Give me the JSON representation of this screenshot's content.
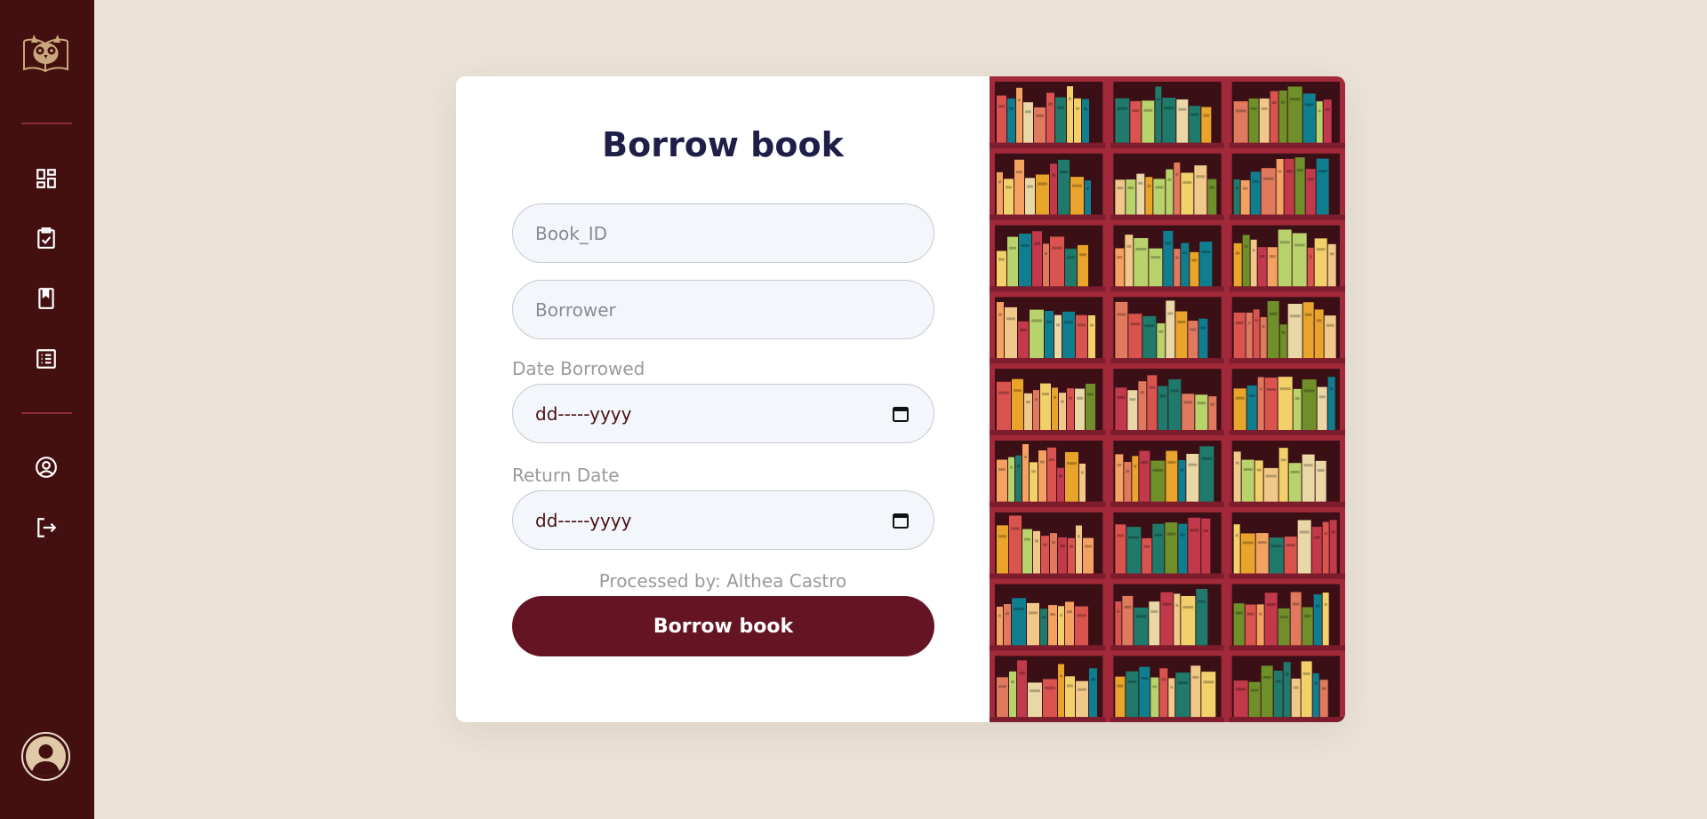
{
  "sidebar": {
    "logo": "owl-book-logo",
    "nav_items": [
      {
        "name": "dashboard",
        "icon": "dashboard-icon"
      },
      {
        "name": "clipboard-check",
        "icon": "clipboard-check-icon"
      },
      {
        "name": "book",
        "icon": "book-icon"
      },
      {
        "name": "list",
        "icon": "list-icon"
      },
      {
        "name": "profile",
        "icon": "user-circle-icon"
      },
      {
        "name": "logout",
        "icon": "logout-icon"
      }
    ],
    "avatar": "user-avatar"
  },
  "form": {
    "title": "Borrow book",
    "book_id_placeholder": "Book_ID",
    "borrower_placeholder": "Borrower",
    "date_borrowed_label": "Date Borrowed",
    "date_borrowed_value": "dd-----yyyy",
    "return_date_label": "Return Date",
    "return_date_value": "dd-----yyyy",
    "processed_by": "Processed by: Althea Castro",
    "submit_label": "Borrow book"
  },
  "colors": {
    "sidebar_bg": "#43100f",
    "page_bg": "#ebe3d8",
    "accent": "#651424",
    "title": "#1e1e48"
  }
}
